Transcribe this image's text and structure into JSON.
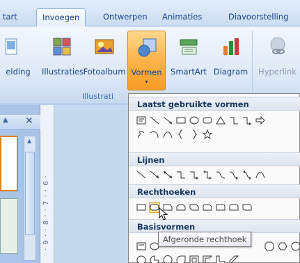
{
  "tabs": [
    "tart",
    "Invoegen",
    "Ontwerpen",
    "Animaties",
    "Diavoorstelling"
  ],
  "ribbon": {
    "buttons": {
      "afbeelding": "elding",
      "illustraties": "Illustraties",
      "fotoalbum": "Fotoalbum",
      "vormen": "Vormen",
      "smartart": "SmartArt",
      "diagram": "Diagram",
      "hyperlink": "Hyperlink"
    },
    "group_label": "Illustrati",
    "dropdown_arrow": "▾"
  },
  "left_panel": {
    "close": "✕"
  },
  "ruler_text": "· 9 · · 8 · · 7 · · 6 ·",
  "shapes_menu": {
    "recent_header": "Laatst gebruikte vormen",
    "lines_header": "Lijnen",
    "rectangles_header": "Rechthoeken",
    "basic_header": "Basisvormen",
    "tooltip": "Afgeronde rechthoek"
  }
}
